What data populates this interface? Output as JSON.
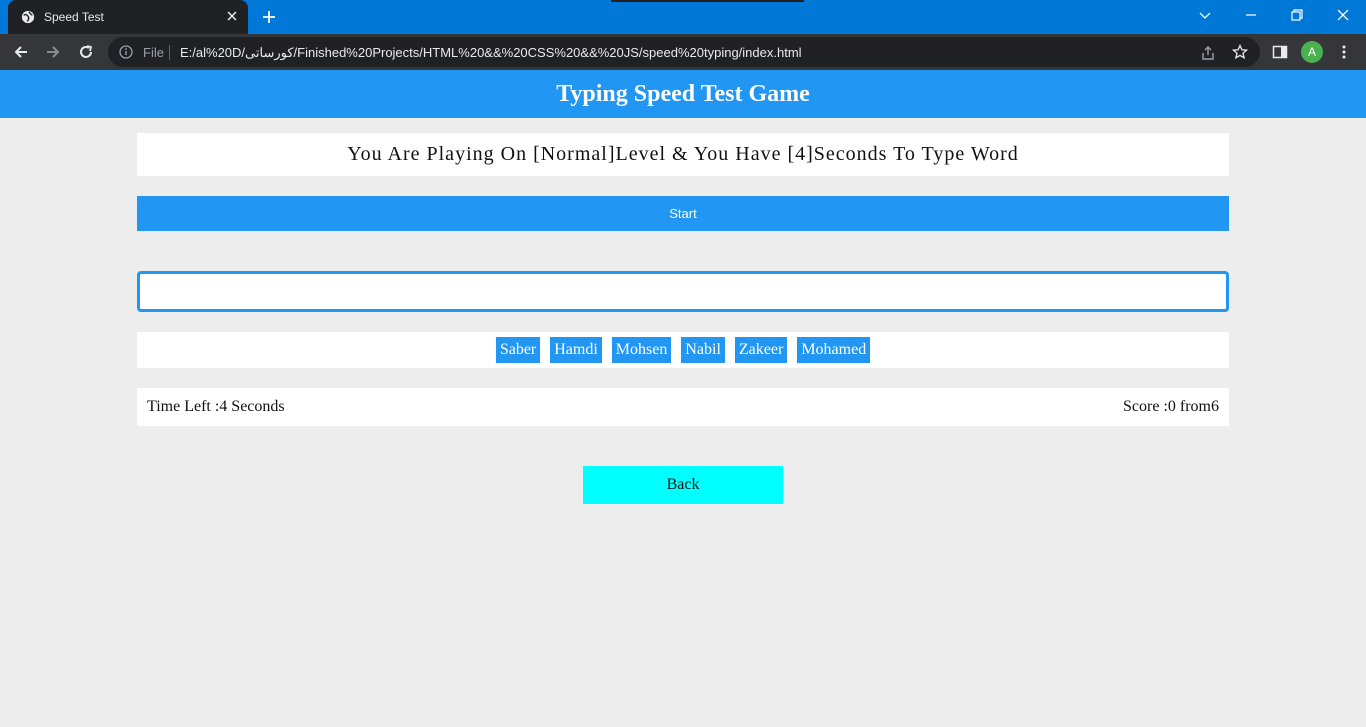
{
  "browser": {
    "tab_title": "Speed Test",
    "url_scheme_label": "File",
    "url": "E:/al%20D/کورساتی/Finished%20Projects/HTML%20&&%20CSS%20&&%20JS/speed%20typing/index.html",
    "profile_initial": "A"
  },
  "page": {
    "title": "Typing Speed Test Game",
    "message": "You Are Playing On [Normal]Level & You Have [4]Seconds To Type Word",
    "start_label": "Start",
    "input_value": "",
    "upcoming_words": [
      "Saber",
      "Hamdi",
      "Mohsen",
      "Nabil",
      "Zakeer",
      "Mohamed"
    ],
    "time_left_text": "Time Left :4 Seconds",
    "score_text": "Score :0 from6",
    "back_label": "Back"
  },
  "colors": {
    "accent": "#2196f3",
    "back_button": "#00ffff",
    "background": "#ededed"
  }
}
